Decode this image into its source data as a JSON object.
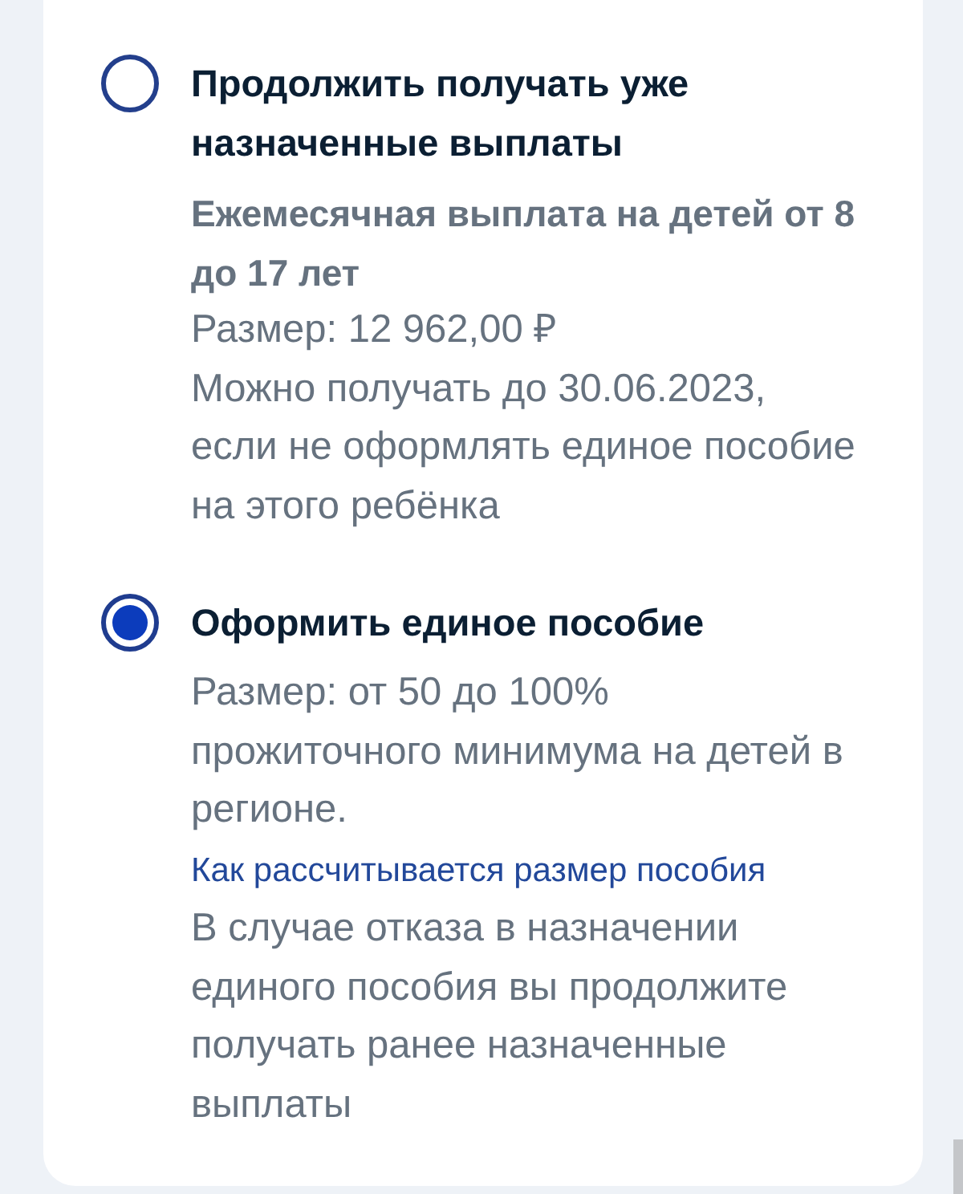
{
  "options": [
    {
      "selected": false,
      "title": "Продолжить получать уже назначенные выплаты",
      "details": [
        {
          "kind": "subtitle",
          "text": "Ежемесячная выплата на детей от 8 до 17 лет"
        },
        {
          "kind": "text",
          "text": "Размер: 12 962,00 ₽"
        },
        {
          "kind": "text",
          "text": "Можно получать до 30.06.2023, если не оформлять единое пособие на этого ребёнка"
        }
      ]
    },
    {
      "selected": true,
      "title": "Оформить единое пособие",
      "details": [
        {
          "kind": "text",
          "text": "Размер: от 50 до 100% прожиточного минимума на детей в регионе.",
          "link": "Как рассчитывается размер пособия"
        },
        {
          "kind": "text",
          "text": "В случае отказа в назначении единого пособия вы продолжите получать ранее назначенные выплаты"
        }
      ]
    }
  ]
}
